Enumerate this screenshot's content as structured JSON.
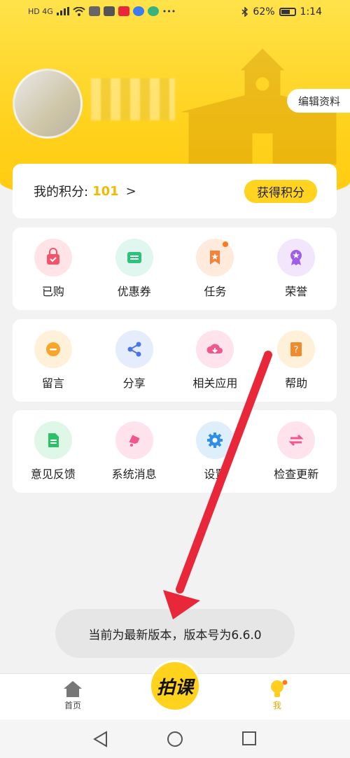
{
  "status_bar": {
    "network": "HD 4G",
    "battery": "62%",
    "time": "1:14"
  },
  "profile": {
    "edit_label": "编辑资料"
  },
  "points": {
    "label": "我的积分:",
    "value": "101",
    "arrow": ">",
    "get_button": "获得积分"
  },
  "grid_rows": [
    [
      {
        "label": "已购",
        "icon": "bag-icon",
        "color": "#ffe3e6"
      },
      {
        "label": "优惠券",
        "icon": "coupon-icon",
        "color": "#dff7ee"
      },
      {
        "label": "任务",
        "icon": "task-icon",
        "color": "#ffeadb"
      },
      {
        "label": "荣誉",
        "icon": "medal-icon",
        "color": "#f1e6fb"
      }
    ],
    [
      {
        "label": "留言",
        "icon": "message-icon",
        "color": "#fff1d9"
      },
      {
        "label": "分享",
        "icon": "share-icon",
        "color": "#e5ecfb"
      },
      {
        "label": "相关应用",
        "icon": "cloud-download-icon",
        "color": "#ffe3ec"
      },
      {
        "label": "帮助",
        "icon": "help-book-icon",
        "color": "#fff0d9"
      }
    ],
    [
      {
        "label": "意见反馈",
        "icon": "feedback-doc-icon",
        "color": "#dff7e6"
      },
      {
        "label": "系统消息",
        "icon": "bell-icon",
        "color": "#ffe3ec"
      },
      {
        "label": "设置",
        "icon": "gear-icon",
        "color": "#dfeefb"
      },
      {
        "label": "检查更新",
        "icon": "refresh-arrows-icon",
        "color": "#ffe3ec"
      }
    ]
  ],
  "toast": "当前为最新版本，版本号为6.6.0",
  "tabbar": {
    "home": "首页",
    "center": "拍课",
    "me": "我"
  },
  "colors": {
    "brand_yellow": "#ffd21e",
    "points_value": "#f5b800",
    "annotation_arrow": "#e8283a"
  }
}
